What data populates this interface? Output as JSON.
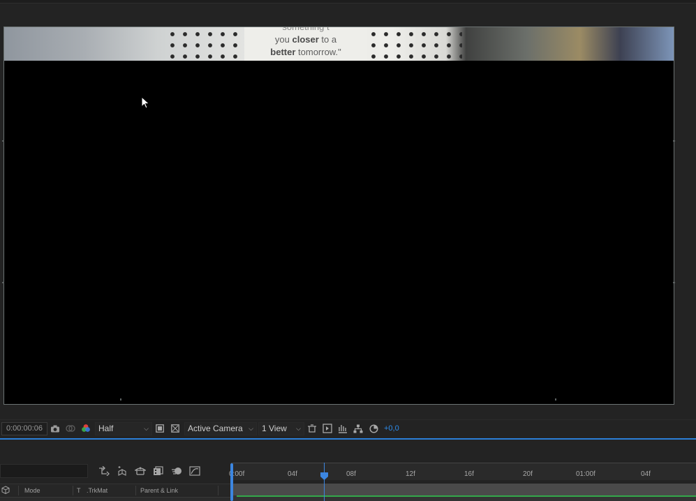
{
  "viewer": {
    "footage_quote": {
      "line1": "something t",
      "line2_pre": "you ",
      "line2_bold": "closer",
      "line2_post": " to a",
      "line3_bold": "better",
      "line3_post": " tomorrow.\""
    }
  },
  "viewer_toolbar": {
    "current_time": "0:00:00:06",
    "resolution": "Half",
    "camera": "Active Camera",
    "view_layout": "1 View",
    "exposure": "+0,0"
  },
  "icons": {
    "snapshot": "camera-icon",
    "show_snapshot": "show-snapshot-icon",
    "channels": "rgb-channels-icon",
    "region_of_interest": "region-of-interest-icon",
    "transparency_grid": "transparency-grid-icon",
    "fast_preview": "fast-preview-icon",
    "flowchart": "flowchart-icon",
    "reset_exposure": "reset-exposure-icon"
  },
  "timeline": {
    "ruler_labels": [
      "0:00f",
      "04f",
      "08f",
      "12f",
      "16f",
      "20f",
      "01:00f",
      "04f"
    ],
    "column_headers": {
      "mode": "Mode",
      "t": "T",
      "trkmat": ".TrkMat",
      "parent": "Parent & Link"
    },
    "accent_color": "#2b7fd8",
    "layer_color": "#33a84a"
  }
}
